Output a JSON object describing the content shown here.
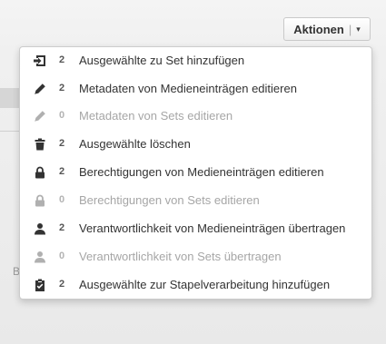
{
  "toolbar": {
    "actions_label": "Aktionen",
    "separator": "|",
    "caret": "▾"
  },
  "background": {
    "letter": "B"
  },
  "colors": {
    "enabled_icon": "#333333",
    "disabled_icon": "#b0b0b0"
  },
  "menu": {
    "items": [
      {
        "icon": "add-to-set-icon",
        "count": "2",
        "label": "Ausgewählte zu Set hinzufügen",
        "enabled": true
      },
      {
        "icon": "pencil-icon",
        "count": "2",
        "label": "Metadaten von Medieneinträgen editieren",
        "enabled": true
      },
      {
        "icon": "pencil-icon",
        "count": "0",
        "label": "Metadaten von Sets editieren",
        "enabled": false
      },
      {
        "icon": "trash-icon",
        "count": "2",
        "label": "Ausgewählte löschen",
        "enabled": true
      },
      {
        "icon": "lock-icon",
        "count": "2",
        "label": "Berechtigungen von Medieneinträgen editieren",
        "enabled": true
      },
      {
        "icon": "lock-icon",
        "count": "0",
        "label": "Berechtigungen von Sets editieren",
        "enabled": false
      },
      {
        "icon": "user-icon",
        "count": "2",
        "label": "Verantwortlichkeit von Medieneinträgen übertragen",
        "enabled": true
      },
      {
        "icon": "user-icon",
        "count": "0",
        "label": "Verantwortlichkeit von Sets übertragen",
        "enabled": false
      },
      {
        "icon": "clipboard-check-icon",
        "count": "2",
        "label": "Ausgewählte zur Stapelverarbeitung hinzufügen",
        "enabled": true
      }
    ]
  }
}
